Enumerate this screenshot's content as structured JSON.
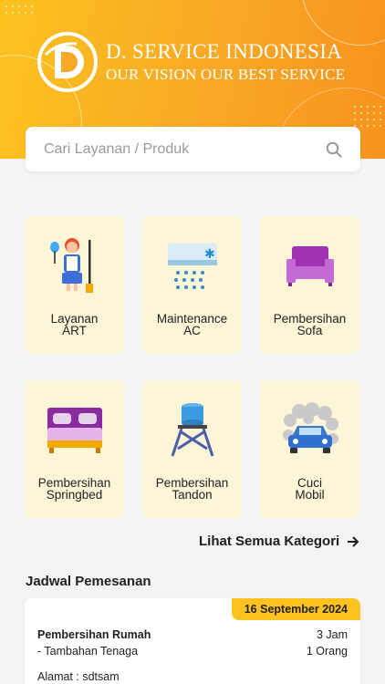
{
  "header": {
    "title": "D. SERVICE INDONESIA",
    "subtitle": "OUR VISION OUR BEST SERVICE",
    "logo_icon": "d-service-logo-icon",
    "gradient": [
      "#fcc21f",
      "#f7931e"
    ]
  },
  "search": {
    "placeholder": "Cari Layanan / Produk",
    "value": "",
    "icon": "search-icon"
  },
  "categories": [
    {
      "line1": "Layanan",
      "line2": "ART",
      "icon": "housekeeper-icon"
    },
    {
      "line1": "Maintenance",
      "line2": "AC",
      "icon": "air-conditioner-icon"
    },
    {
      "line1": "Pembersihan",
      "line2": "Sofa",
      "icon": "sofa-icon"
    },
    {
      "line1": "Pembersihan",
      "line2": "Springbed",
      "icon": "bed-icon"
    },
    {
      "line1": "Pembersihan",
      "line2": "Tandon",
      "icon": "water-tower-icon"
    },
    {
      "line1": "Cuci",
      "line2": "Mobil",
      "icon": "car-wash-icon"
    }
  ],
  "see_all": {
    "label": "Lihat Semua Kategori",
    "icon": "arrow-right-icon"
  },
  "schedule": {
    "title": "Jadwal Pemesanan",
    "orders": [
      {
        "date": "16 September 2024",
        "service": "Pembersihan Rumah",
        "duration": "3 Jam",
        "extra": "- Tambahan Tenaga",
        "people": "1 Orang",
        "address": "Alamat : sdtsam"
      }
    ]
  },
  "colors": {
    "accent": "#fcc21f",
    "card_bg": "#fdf5d7",
    "page_bg": "#f4f4f4"
  }
}
